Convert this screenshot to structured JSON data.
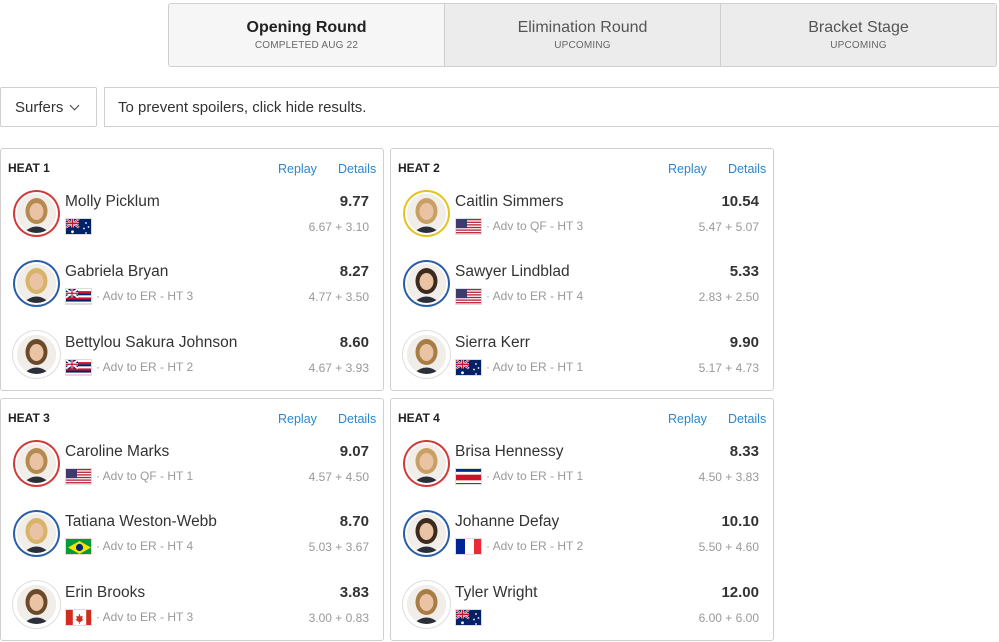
{
  "rounds": [
    {
      "name": "Opening Round",
      "status": "COMPLETED AUG 22"
    },
    {
      "name": "Elimination Round",
      "status": "UPCOMING"
    },
    {
      "name": "Bracket Stage",
      "status": "UPCOMING"
    }
  ],
  "filter": {
    "select_label": "Surfers",
    "spoiler_note": "To prevent spoilers, click hide results."
  },
  "links": {
    "replay": "Replay",
    "details": "Details"
  },
  "colors": {
    "accent_link": "#2a87d0",
    "ring_red": "#d23a3a",
    "ring_yellow": "#e5c21c",
    "ring_blue": "#2b5ea8",
    "ring_white": "#ffffff"
  },
  "heats": [
    {
      "title": "HEAT 1",
      "surfers": [
        {
          "name": "Molly Picklum",
          "flag": "AUS",
          "ring": "red",
          "adv": "",
          "total": "9.77",
          "waves": "6.67 + 3.10"
        },
        {
          "name": "Gabriela Bryan",
          "flag": "HAW",
          "ring": "blue",
          "adv": "· Adv to ER - HT 3",
          "total": "8.27",
          "waves": "4.77 + 3.50"
        },
        {
          "name": "Bettylou Sakura Johnson",
          "flag": "HAW",
          "ring": "white",
          "adv": "· Adv to ER - HT 2",
          "total": "8.60",
          "waves": "4.67 + 3.93"
        }
      ]
    },
    {
      "title": "HEAT 2",
      "surfers": [
        {
          "name": "Caitlin Simmers",
          "flag": "USA",
          "ring": "yellow",
          "adv": "· Adv to QF - HT 3",
          "total": "10.54",
          "waves": "5.47 + 5.07"
        },
        {
          "name": "Sawyer Lindblad",
          "flag": "USA",
          "ring": "blue",
          "adv": "· Adv to ER - HT 4",
          "total": "5.33",
          "waves": "2.83 + 2.50"
        },
        {
          "name": "Sierra Kerr",
          "flag": "AUS",
          "ring": "white",
          "adv": "· Adv to ER - HT 1",
          "total": "9.90",
          "waves": "5.17 + 4.73"
        }
      ]
    },
    {
      "title": "HEAT 3",
      "surfers": [
        {
          "name": "Caroline Marks",
          "flag": "USA",
          "ring": "red",
          "adv": "· Adv to QF - HT 1",
          "total": "9.07",
          "waves": "4.57 + 4.50"
        },
        {
          "name": "Tatiana Weston-Webb",
          "flag": "BRA",
          "ring": "blue",
          "adv": "· Adv to ER - HT 4",
          "total": "8.70",
          "waves": "5.03 + 3.67"
        },
        {
          "name": "Erin Brooks",
          "flag": "CAN",
          "ring": "white",
          "adv": "· Adv to ER - HT 3",
          "total": "3.83",
          "waves": "3.00 + 0.83"
        }
      ]
    },
    {
      "title": "HEAT 4",
      "surfers": [
        {
          "name": "Brisa Hennessy",
          "flag": "CRC",
          "ring": "red",
          "adv": "· Adv to ER - HT 1",
          "total": "8.33",
          "waves": "4.50 + 3.83"
        },
        {
          "name": "Johanne Defay",
          "flag": "FRA",
          "ring": "blue",
          "adv": "· Adv to ER - HT 2",
          "total": "10.10",
          "waves": "5.50 + 4.60"
        },
        {
          "name": "Tyler Wright",
          "flag": "AUS",
          "ring": "white",
          "adv": "",
          "total": "12.00",
          "waves": "6.00 + 6.00"
        }
      ]
    }
  ]
}
